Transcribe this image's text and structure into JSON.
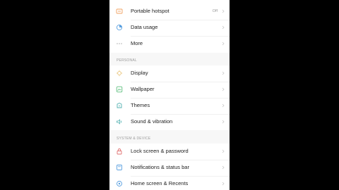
{
  "colors": {
    "screen_background": "#f7f7f7",
    "card_background": "#ffffff",
    "text_primary": "#222222",
    "text_secondary": "#9a9a9a",
    "icon_orange": "#f0a060",
    "icon_blue": "#5aa0e0",
    "icon_gray": "#b0b0b0",
    "icon_yellow": "#e8c070",
    "icon_green": "#60c080",
    "icon_teal": "#50b0b0",
    "icon_red": "#e07070"
  },
  "network": {
    "items": [
      {
        "label": "Portable hotspot",
        "value": "Off",
        "icon": "hotspot-icon"
      },
      {
        "label": "Data usage",
        "icon": "data-usage-icon"
      },
      {
        "label": "More",
        "icon": "more-dots-icon"
      }
    ]
  },
  "personal": {
    "header": "PERSONAL",
    "items": [
      {
        "label": "Display",
        "icon": "display-icon"
      },
      {
        "label": "Wallpaper",
        "icon": "wallpaper-icon"
      },
      {
        "label": "Themes",
        "icon": "themes-icon"
      },
      {
        "label": "Sound & vibration",
        "icon": "sound-icon"
      }
    ]
  },
  "system": {
    "header": "SYSTEM & DEVICE",
    "items": [
      {
        "label": "Lock screen & password",
        "icon": "lock-icon"
      },
      {
        "label": "Notifications & status bar",
        "icon": "notifications-icon"
      },
      {
        "label": "Home screen & Recents",
        "icon": "home-screen-icon"
      }
    ]
  }
}
